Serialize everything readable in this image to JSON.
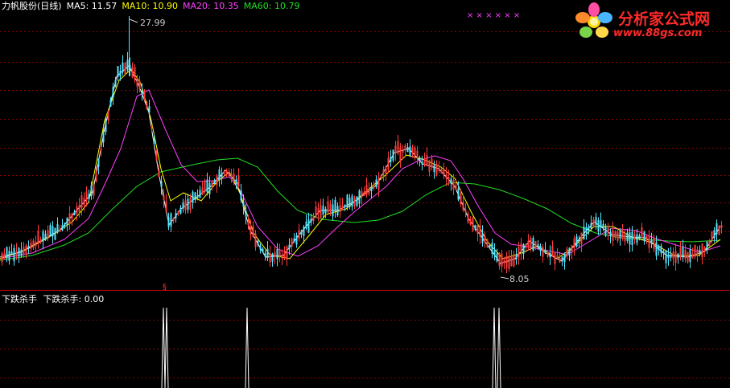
{
  "header": {
    "stock_title": "力帆股份(日线)",
    "ma5_label": "MA5: 11.57",
    "ma10_label": "MA10: 10.90",
    "ma20_label": "MA20: 10.35",
    "ma60_label": "MA60: 10.79"
  },
  "colors": {
    "background": "#000000",
    "grid": "#8b0000",
    "divider": "#b00000",
    "candle_up": "#ff3b3b",
    "candle_down": "#55e6ff",
    "ma5": "#ffffff",
    "ma10": "#ffff00",
    "ma20": "#ff40ff",
    "ma60": "#22dd22",
    "marker": "#ff40ff",
    "signal": "#ffffff"
  },
  "annotations": {
    "high_label": "27.99",
    "low_label": "8.05",
    "top_markers": "×  × × × × ×"
  },
  "indicator": {
    "name": "下跌杀手",
    "value_label": "下跌杀手: 0.00"
  },
  "logo": {
    "brand_text": "分析家公式网",
    "url_text": "www.88gs.com",
    "icon": "flower-logo-icon"
  }
}
